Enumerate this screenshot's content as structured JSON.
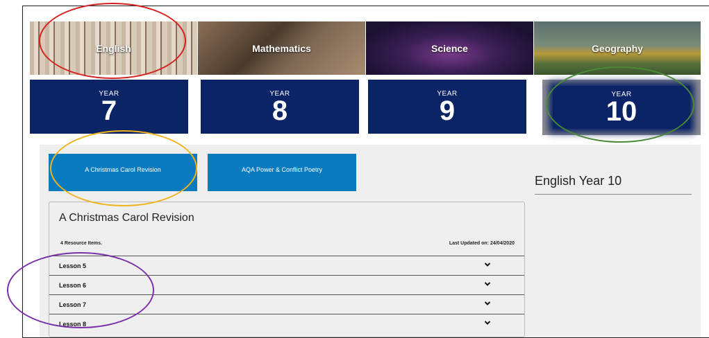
{
  "subjects": [
    {
      "label": "English"
    },
    {
      "label": "Mathematics"
    },
    {
      "label": "Science"
    },
    {
      "label": "Geography"
    }
  ],
  "years": [
    {
      "label": "YEAR",
      "number": "7"
    },
    {
      "label": "YEAR",
      "number": "8"
    },
    {
      "label": "YEAR",
      "number": "9"
    },
    {
      "label": "YEAR",
      "number": "10"
    }
  ],
  "topics": [
    {
      "label": "A Christmas Carol Revision"
    },
    {
      "label": "AQA Power & Conflict Poetry"
    }
  ],
  "sidebar": {
    "title": "English Year 10"
  },
  "panel": {
    "title": "A Christmas Carol Revision",
    "resource_count": "4 Resource Items.",
    "last_updated": "Last Updated on: 24/04/2020",
    "lessons": [
      {
        "label": "Lesson 5"
      },
      {
        "label": "Lesson 6"
      },
      {
        "label": "Lesson 7"
      },
      {
        "label": "Lesson 8"
      }
    ]
  },
  "colors": {
    "year_tile": "#0b2466",
    "topic_button": "#0a7bbf",
    "annotation_red": "#d62020",
    "annotation_green": "#4a8a34",
    "annotation_yellow": "#f2b21c",
    "annotation_purple": "#7b2fa8"
  },
  "icons": {
    "expand": "chevron-down-icon"
  }
}
